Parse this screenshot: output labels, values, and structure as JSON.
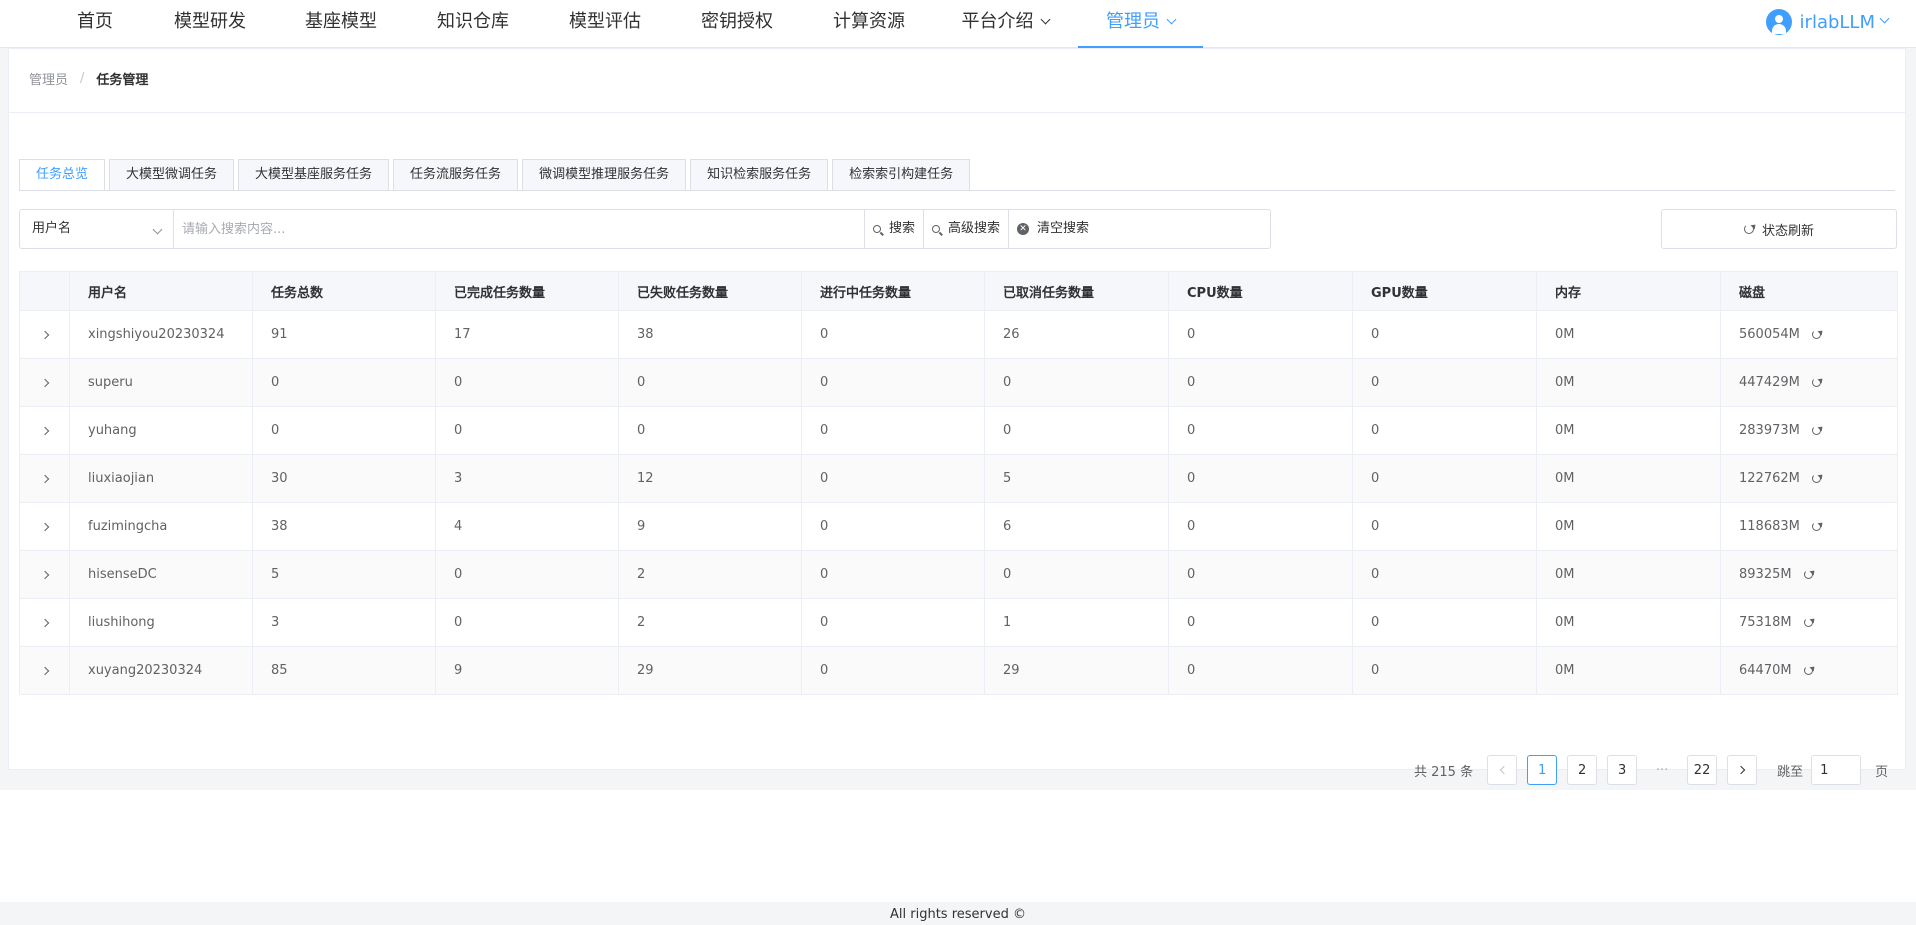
{
  "nav": {
    "items": [
      {
        "label": "首页"
      },
      {
        "label": "模型研发"
      },
      {
        "label": "基座模型"
      },
      {
        "label": "知识仓库"
      },
      {
        "label": "模型评估"
      },
      {
        "label": "密钥授权"
      },
      {
        "label": "计算资源"
      },
      {
        "label": "平台介绍"
      },
      {
        "label": "管理员"
      }
    ],
    "user": "irlabLLM"
  },
  "breadcrumb": {
    "root": "管理员",
    "separator": "/",
    "current": "任务管理"
  },
  "tabs": [
    {
      "label": "任务总览"
    },
    {
      "label": "大模型微调任务"
    },
    {
      "label": "大模型基座服务任务"
    },
    {
      "label": "任务流服务任务"
    },
    {
      "label": "微调模型推理服务任务"
    },
    {
      "label": "知识检索服务任务"
    },
    {
      "label": "检索索引构建任务"
    }
  ],
  "search": {
    "field_selected": "用户名",
    "placeholder": "请输入搜索内容...",
    "search_label": "搜索",
    "advanced_label": "高级搜索",
    "clear_label": "清空搜索",
    "refresh_label": "状态刷新"
  },
  "table": {
    "columns": [
      "用户名",
      "任务总数",
      "已完成任务数量",
      "已失败任务数量",
      "进行中任务数量",
      "已取消任务数量",
      "CPU数量",
      "GPU数量",
      "内存",
      "磁盘"
    ],
    "rows": [
      {
        "user": "xingshiyou20230324",
        "total": "91",
        "done": "17",
        "failed": "38",
        "running": "0",
        "cancelled": "26",
        "cpu": "0",
        "gpu": "0",
        "mem": "0M",
        "disk": "560054M"
      },
      {
        "user": "superu",
        "total": "0",
        "done": "0",
        "failed": "0",
        "running": "0",
        "cancelled": "0",
        "cpu": "0",
        "gpu": "0",
        "mem": "0M",
        "disk": "447429M"
      },
      {
        "user": "yuhang",
        "total": "0",
        "done": "0",
        "failed": "0",
        "running": "0",
        "cancelled": "0",
        "cpu": "0",
        "gpu": "0",
        "mem": "0M",
        "disk": "283973M"
      },
      {
        "user": "liuxiaojian",
        "total": "30",
        "done": "3",
        "failed": "12",
        "running": "0",
        "cancelled": "5",
        "cpu": "0",
        "gpu": "0",
        "mem": "0M",
        "disk": "122762M"
      },
      {
        "user": "fuzimingcha",
        "total": "38",
        "done": "4",
        "failed": "9",
        "running": "0",
        "cancelled": "6",
        "cpu": "0",
        "gpu": "0",
        "mem": "0M",
        "disk": "118683M"
      },
      {
        "user": "hisenseDC",
        "total": "5",
        "done": "0",
        "failed": "2",
        "running": "0",
        "cancelled": "0",
        "cpu": "0",
        "gpu": "0",
        "mem": "0M",
        "disk": "89325M"
      },
      {
        "user": "liushihong",
        "total": "3",
        "done": "0",
        "failed": "2",
        "running": "0",
        "cancelled": "1",
        "cpu": "0",
        "gpu": "0",
        "mem": "0M",
        "disk": "75318M"
      },
      {
        "user": "xuyang20230324",
        "total": "85",
        "done": "9",
        "failed": "29",
        "running": "0",
        "cancelled": "29",
        "cpu": "0",
        "gpu": "0",
        "mem": "0M",
        "disk": "64470M"
      }
    ]
  },
  "pagination": {
    "total_text": "共 215 条",
    "pages": [
      "1",
      "2",
      "3"
    ],
    "ellipsis": "···",
    "last_page": "22",
    "jump_label": "跳至",
    "jump_value": "1",
    "unit": "页"
  },
  "footer": {
    "text": "All rights reserved ©"
  },
  "colors": {
    "accent": "#409eff",
    "text": "#303133",
    "muted": "#606266"
  }
}
